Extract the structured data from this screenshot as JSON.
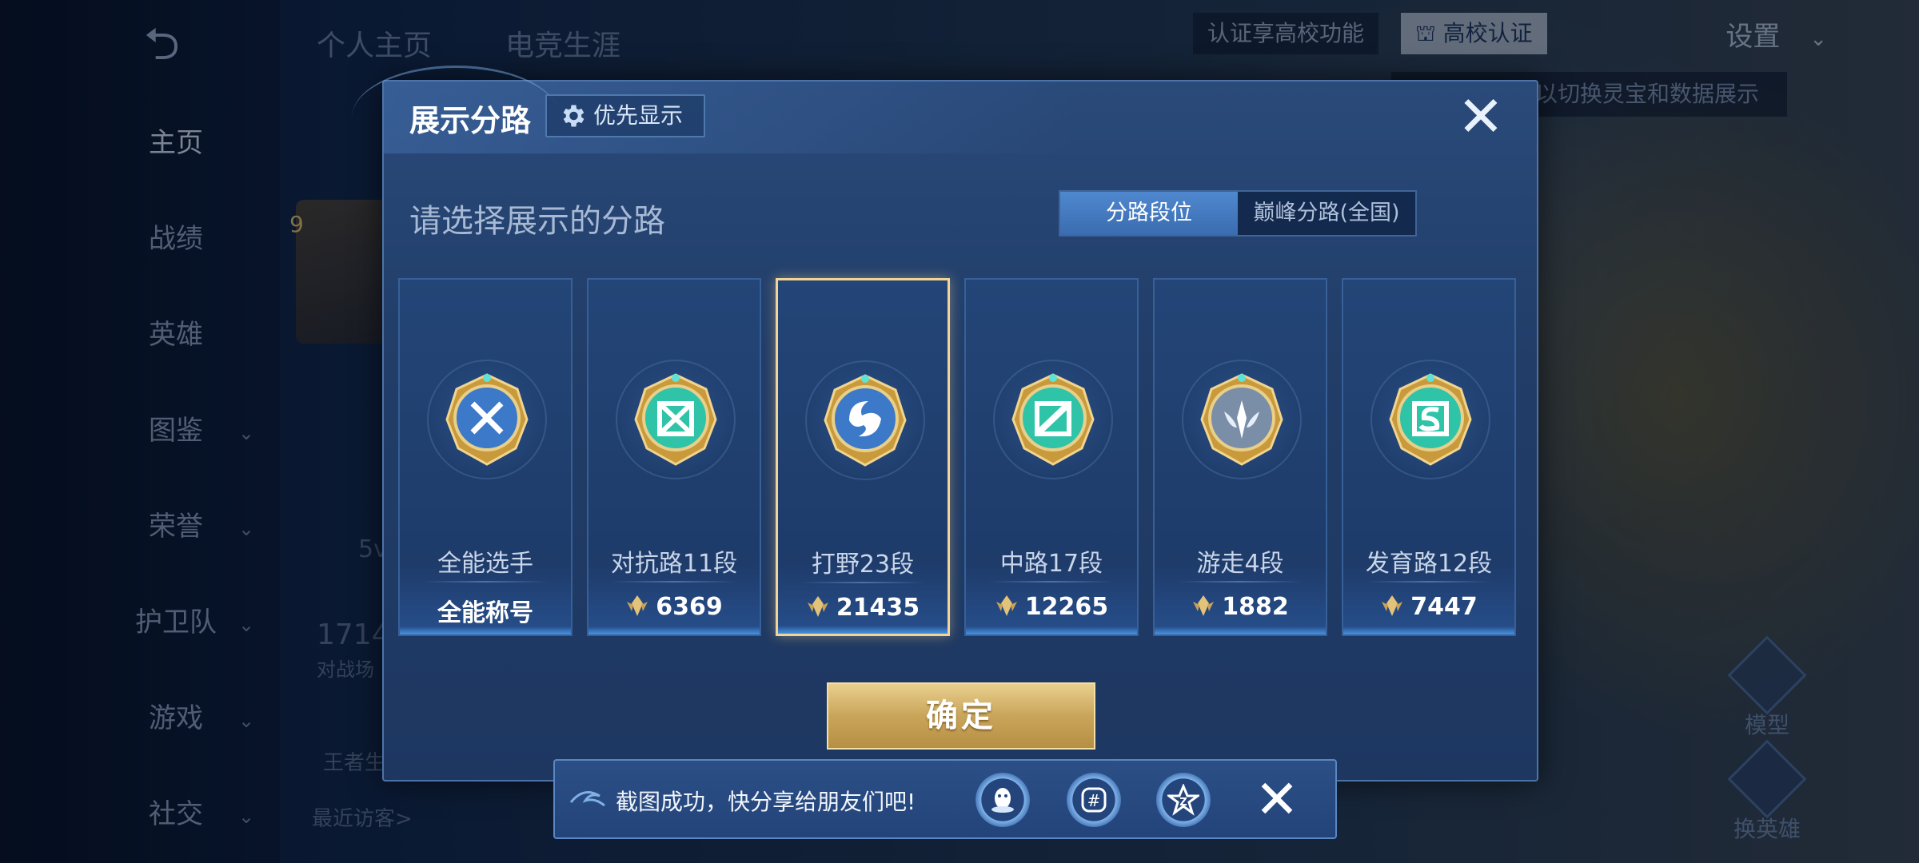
{
  "background": {
    "nav": [
      {
        "label": "主页",
        "active": true,
        "chevron": false
      },
      {
        "label": "战绩",
        "active": false,
        "chevron": false
      },
      {
        "label": "英雄",
        "active": false,
        "chevron": false
      },
      {
        "label": "图鉴",
        "active": false,
        "chevron": true
      },
      {
        "label": "荣誉",
        "active": false,
        "chevron": true
      },
      {
        "label": "护卫队",
        "active": false,
        "chevron": true
      },
      {
        "label": "游戏",
        "active": false,
        "chevron": true
      },
      {
        "label": "社交",
        "active": false,
        "chevron": true
      }
    ],
    "tabs": [
      "个人主页",
      "电竞生涯"
    ],
    "certify_text": "认证享高校功能",
    "campus_cert": "高校认证",
    "settings": "设置",
    "hint": "以切换灵宝和数据展示",
    "level_badge": "9",
    "stat_1714": "1714",
    "stat_label": "对战场",
    "bg_5v": "5v",
    "wangzhe": "王者生",
    "recent_visitors": "最近访客>",
    "model_label": "模型",
    "switch_hero_label": "换英雄"
  },
  "dialog": {
    "title": "展示分路",
    "priority_label": "优先显示",
    "subtitle": "请选择展示的分路",
    "toggle": {
      "left": "分路段位",
      "right": "巅峰分路(全国)",
      "selected": "left"
    },
    "cards": [
      {
        "name": "全能选手",
        "stat": "全能称号",
        "show_mark": false,
        "selected": false,
        "emblem": "all-round-icon",
        "color": "#3d79c9"
      },
      {
        "name": "对抗路11段",
        "stat": "6369",
        "show_mark": true,
        "selected": false,
        "emblem": "clash-lane-icon",
        "color": "#2fc4a8"
      },
      {
        "name": "打野23段",
        "stat": "21435",
        "show_mark": true,
        "selected": true,
        "emblem": "jungle-icon",
        "color": "#3d79c9"
      },
      {
        "name": "中路17段",
        "stat": "12265",
        "show_mark": true,
        "selected": false,
        "emblem": "mid-lane-icon",
        "color": "#2fc4a8"
      },
      {
        "name": "游走4段",
        "stat": "1882",
        "show_mark": true,
        "selected": false,
        "emblem": "roam-icon",
        "color": "#7b8ea8"
      },
      {
        "name": "发育路12段",
        "stat": "7447",
        "show_mark": true,
        "selected": false,
        "emblem": "farm-lane-icon",
        "color": "#2fc4a8"
      }
    ],
    "confirm_label": "确定"
  },
  "toast": {
    "message": "截图成功，快分享给朋友们吧!",
    "share_targets": [
      "qq-icon",
      "wechat-moments-icon",
      "qzone-icon"
    ]
  },
  "colors": {
    "accent_gold": "#f0d49a",
    "dialog_bg": "#213d68",
    "toggle_on": "#4f88cf"
  }
}
